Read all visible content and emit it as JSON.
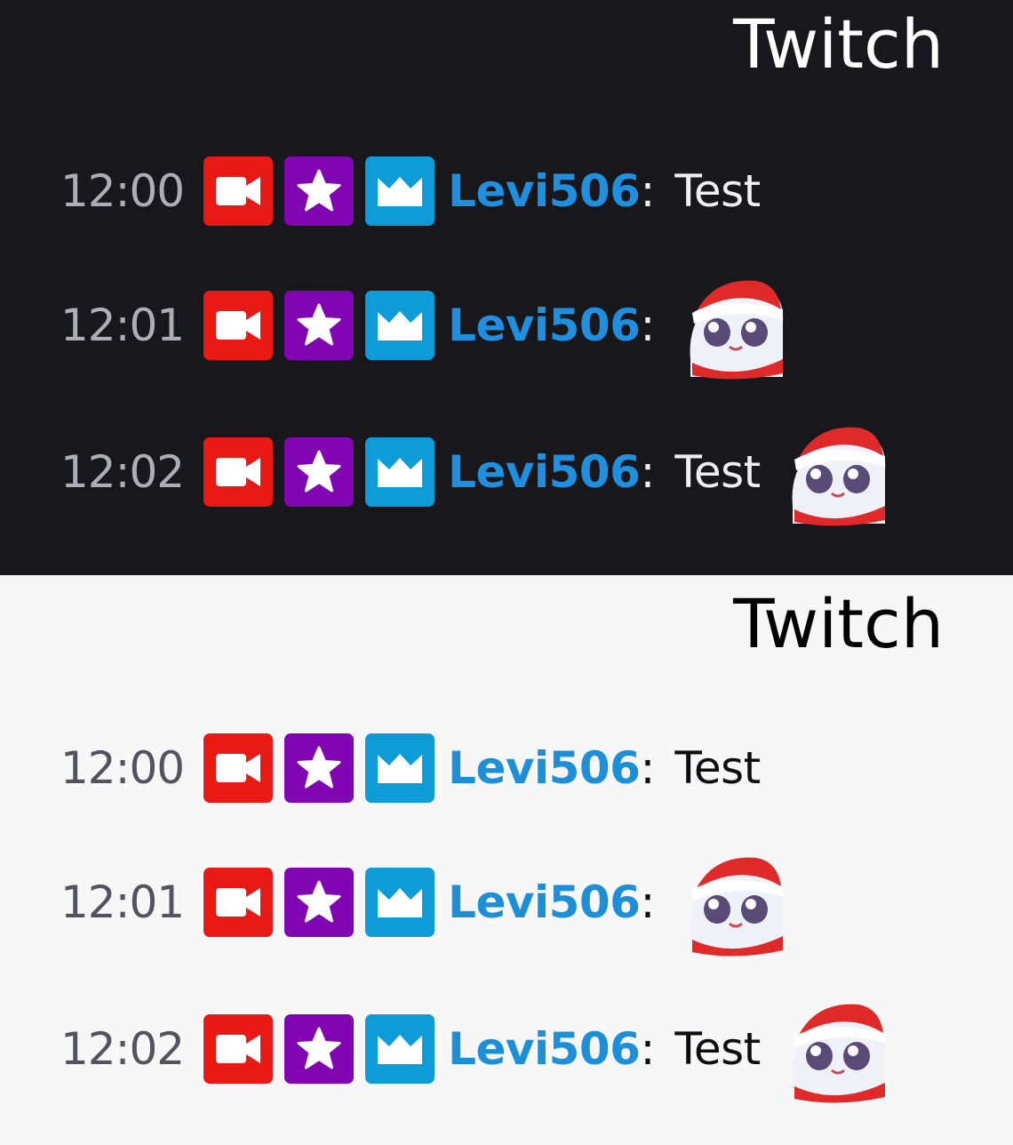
{
  "panels": [
    {
      "theme": "dark",
      "title": "Twitch",
      "messages": [
        {
          "time": "12:00",
          "user": "Levi506",
          "sep": ":",
          "text": "Test",
          "emote": false
        },
        {
          "time": "12:01",
          "user": "Levi506",
          "sep": ":",
          "text": "",
          "emote": true
        },
        {
          "time": "12:02",
          "user": "Levi506",
          "sep": ":",
          "text": "Test",
          "emote": true
        }
      ]
    },
    {
      "theme": "light",
      "title": "Twitch",
      "messages": [
        {
          "time": "12:00",
          "user": "Levi506",
          "sep": ":",
          "text": "Test",
          "emote": false
        },
        {
          "time": "12:01",
          "user": "Levi506",
          "sep": ":",
          "text": "",
          "emote": true
        },
        {
          "time": "12:02",
          "user": "Levi506",
          "sep": ":",
          "text": "Test",
          "emote": true
        }
      ]
    }
  ],
  "badges": [
    {
      "name": "broadcaster",
      "icon": "video-camera-icon",
      "color": "#e91916"
    },
    {
      "name": "subscriber",
      "icon": "star-icon",
      "color": "#8205b4"
    },
    {
      "name": "prime",
      "icon": "crown-icon",
      "color": "#0d9cd8"
    }
  ],
  "emote_icon": "santa-hat-emote-icon",
  "colors": {
    "dark_bg": "#18171c",
    "light_bg": "#f7f7f8",
    "username": "#1f8fe0"
  }
}
